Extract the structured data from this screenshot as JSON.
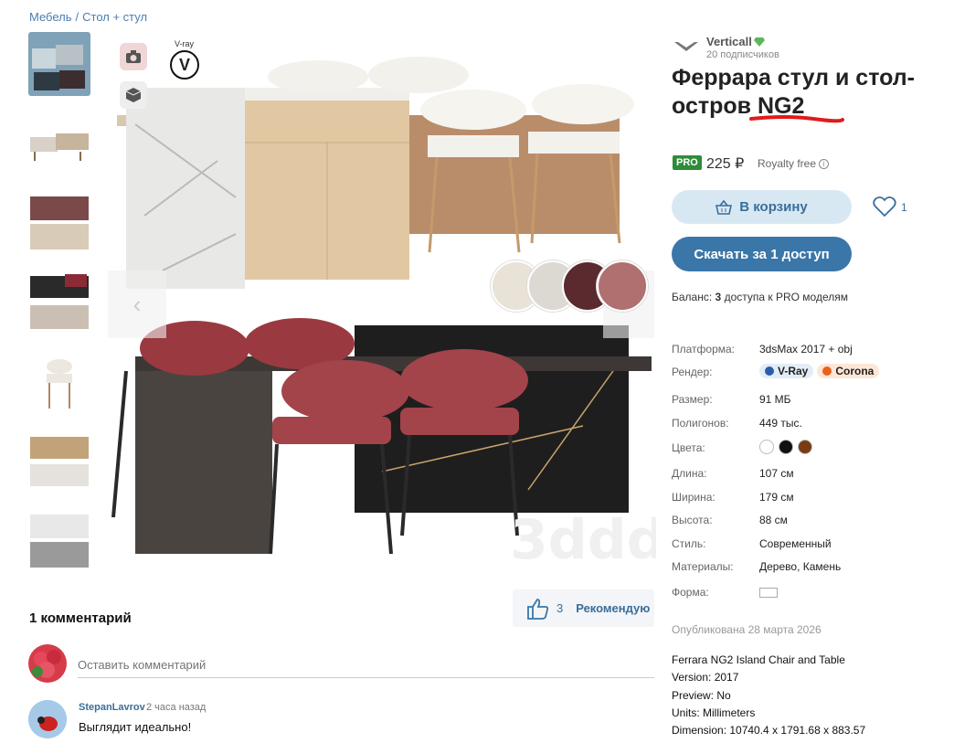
{
  "breadcrumb": {
    "first": "Мебель",
    "separator": "/",
    "second": "Стол + стул"
  },
  "viewer": {
    "vray_label": "V-ray",
    "vray_glyph": "V",
    "prev_arrow": "‹"
  },
  "recommend": {
    "count": "3",
    "label": "Рекомендую"
  },
  "comments": {
    "title": "1 комментарий",
    "input_placeholder": "Оставить комментарий",
    "items": [
      {
        "author": "StepanLavrov",
        "time": "2 часа назад",
        "text": "Выглядит идеально!"
      }
    ]
  },
  "author": {
    "name": "Verticall",
    "subscribers": "20 подписчиков"
  },
  "product": {
    "title": "Феррара стул и стол-остров NG2",
    "pro_badge": "PRO",
    "price": "225 ₽",
    "license": "Royalty free",
    "info_glyph": "i",
    "cart_label": "В корзину",
    "likes": "1",
    "download_label": "Скачать за 1 доступ",
    "balance_prefix": "Баланс:",
    "balance_count": "3",
    "balance_suffix": "доступа к PRO моделям"
  },
  "specs": {
    "platform_key": "Платформа:",
    "platform_val": "3dsMax 2017 + obj",
    "render_key": "Рендер:",
    "render_vray": "V-Ray",
    "render_corona": "Corona",
    "size_key": "Размер:",
    "size_val": "91 МБ",
    "polys_key": "Полигонов:",
    "polys_val": "449 тыс.",
    "colors_key": "Цвета:",
    "colors": [
      "#ffffff",
      "#111111",
      "#7a3b10"
    ],
    "length_key": "Длина:",
    "length_val": "107 см",
    "width_key": "Ширина:",
    "width_val": "179 см",
    "height_key": "Высота:",
    "height_val": "88 см",
    "style_key": "Стиль:",
    "style_val": "Современный",
    "materials_key": "Материалы:",
    "materials_val": "Дерево, Камень",
    "shape_key": "Форма:"
  },
  "published": "Опубликована 28 марта 2026",
  "description": [
    "Ferrara NG2 Island Chair and Table",
    "Version: 2017",
    "Preview: No",
    "Units: Millimeters",
    "Dimension: 10740.4 x 1791.68 x 883.57"
  ],
  "accent": "#3a76a8",
  "pro_color": "#2e8b3a"
}
